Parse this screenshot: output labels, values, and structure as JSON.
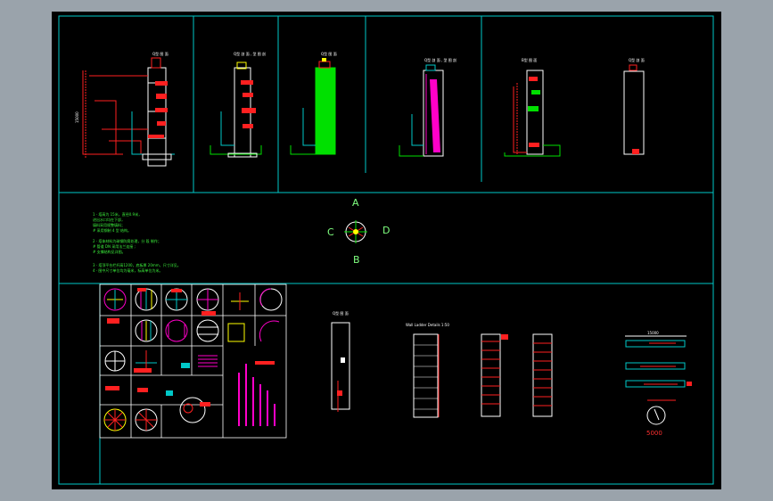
{
  "drawing": {
    "compass": {
      "top": "A",
      "bottom": "B",
      "left": "C",
      "right": "D"
    },
    "scale_label": "5000",
    "dimension_top": "15000",
    "colors": {
      "background": "#000000",
      "frame": "#00c8c8",
      "elevation": "#ffffff",
      "annotation": "#ff2020",
      "notes": "#3cf03c",
      "highlight_green": "#00e000",
      "highlight_magenta": "#ff00c8",
      "highlight_yellow": "#ffff00"
    }
  }
}
